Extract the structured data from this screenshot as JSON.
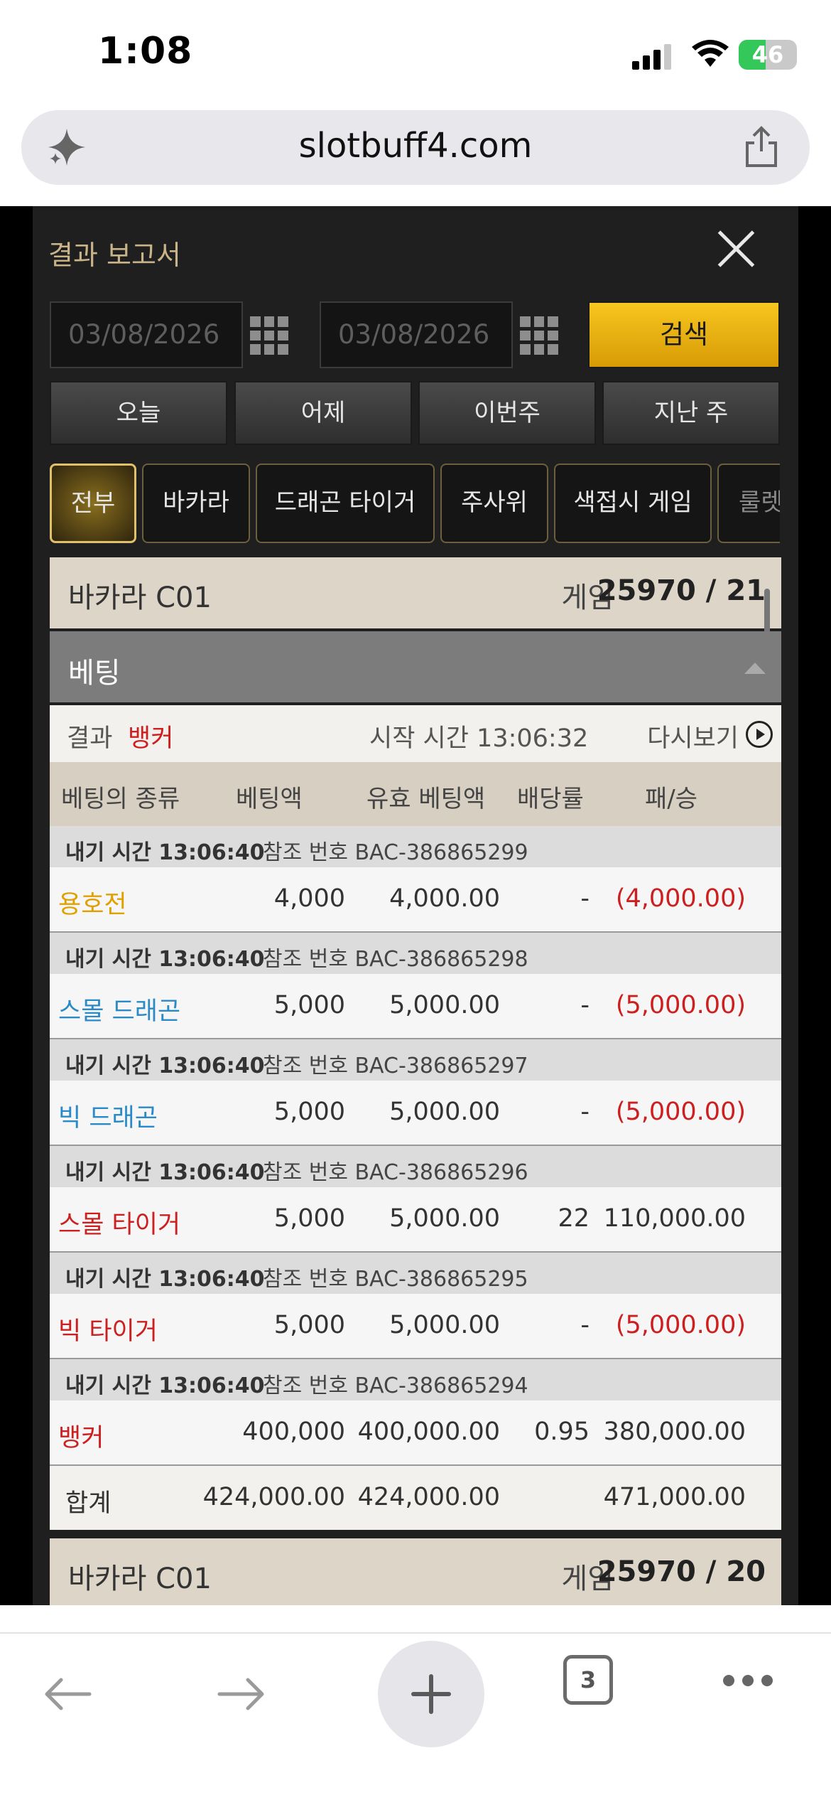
{
  "status_bar": {
    "time": "1:08",
    "battery": "46"
  },
  "browser": {
    "url": "slotbuff4.com",
    "tab_count": "3"
  },
  "modal": {
    "title": "결과 보고서",
    "date_from": "03/08/2026",
    "date_to": "03/08/2026",
    "search_label": "검색",
    "quick_ranges": [
      "오늘",
      "어제",
      "이번주",
      "지난 주"
    ],
    "game_tabs": [
      "전부",
      "바카라",
      "드래곤 타이거",
      "주사위",
      "색접시 게임",
      "룰렛"
    ],
    "active_tab": "전부"
  },
  "game": {
    "name": "바카라 C01",
    "label": "게임",
    "number": "25970 / 21"
  },
  "betting": {
    "title": "베팅",
    "result_label": "결과",
    "result_value": "뱅커",
    "start_time": "시작 시간 13:06:32",
    "replay_label": "다시보기",
    "columns": [
      "베팅의 종류",
      "베팅액",
      "유효 베팅액",
      "배당률",
      "패/승"
    ],
    "entries": [
      {
        "time": "내기 시간 13:06:40",
        "ref": "참조 번호 BAC-386865299",
        "type": "용호전",
        "type_color": "#e0a000",
        "bet": "4,000",
        "valid": "4,000.00",
        "odds": "-",
        "win": "(4,000.00)",
        "negative": true
      },
      {
        "time": "내기 시간 13:06:40",
        "ref": "참조 번호 BAC-386865298",
        "type": "스몰 드래곤",
        "type_color": "#2a8ac8",
        "bet": "5,000",
        "valid": "5,000.00",
        "odds": "-",
        "win": "(5,000.00)",
        "negative": true
      },
      {
        "time": "내기 시간 13:06:40",
        "ref": "참조 번호 BAC-386865297",
        "type": "빅 드래곤",
        "type_color": "#2a8ac8",
        "bet": "5,000",
        "valid": "5,000.00",
        "odds": "-",
        "win": "(5,000.00)",
        "negative": true
      },
      {
        "time": "내기 시간 13:06:40",
        "ref": "참조 번호 BAC-386865296",
        "type": "스몰 타이거",
        "type_color": "#cc1f1f",
        "bet": "5,000",
        "valid": "5,000.00",
        "odds": "22",
        "win": "110,000.00",
        "negative": false
      },
      {
        "time": "내기 시간 13:06:40",
        "ref": "참조 번호 BAC-386865295",
        "type": "빅 타이거",
        "type_color": "#cc1f1f",
        "bet": "5,000",
        "valid": "5,000.00",
        "odds": "-",
        "win": "(5,000.00)",
        "negative": true
      },
      {
        "time": "내기 시간 13:06:40",
        "ref": "참조 번호 BAC-386865294",
        "type": "뱅커",
        "type_color": "#cc1f1f",
        "bet": "400,000",
        "valid": "400,000.00",
        "odds": "0.95",
        "win": "380,000.00",
        "negative": false
      }
    ],
    "total": {
      "label": "합계",
      "bet": "424,000.00",
      "valid": "424,000.00",
      "win": "471,000.00"
    }
  },
  "game2": {
    "name": "바카라 C01",
    "label": "게임",
    "number": "25970 / 20"
  }
}
